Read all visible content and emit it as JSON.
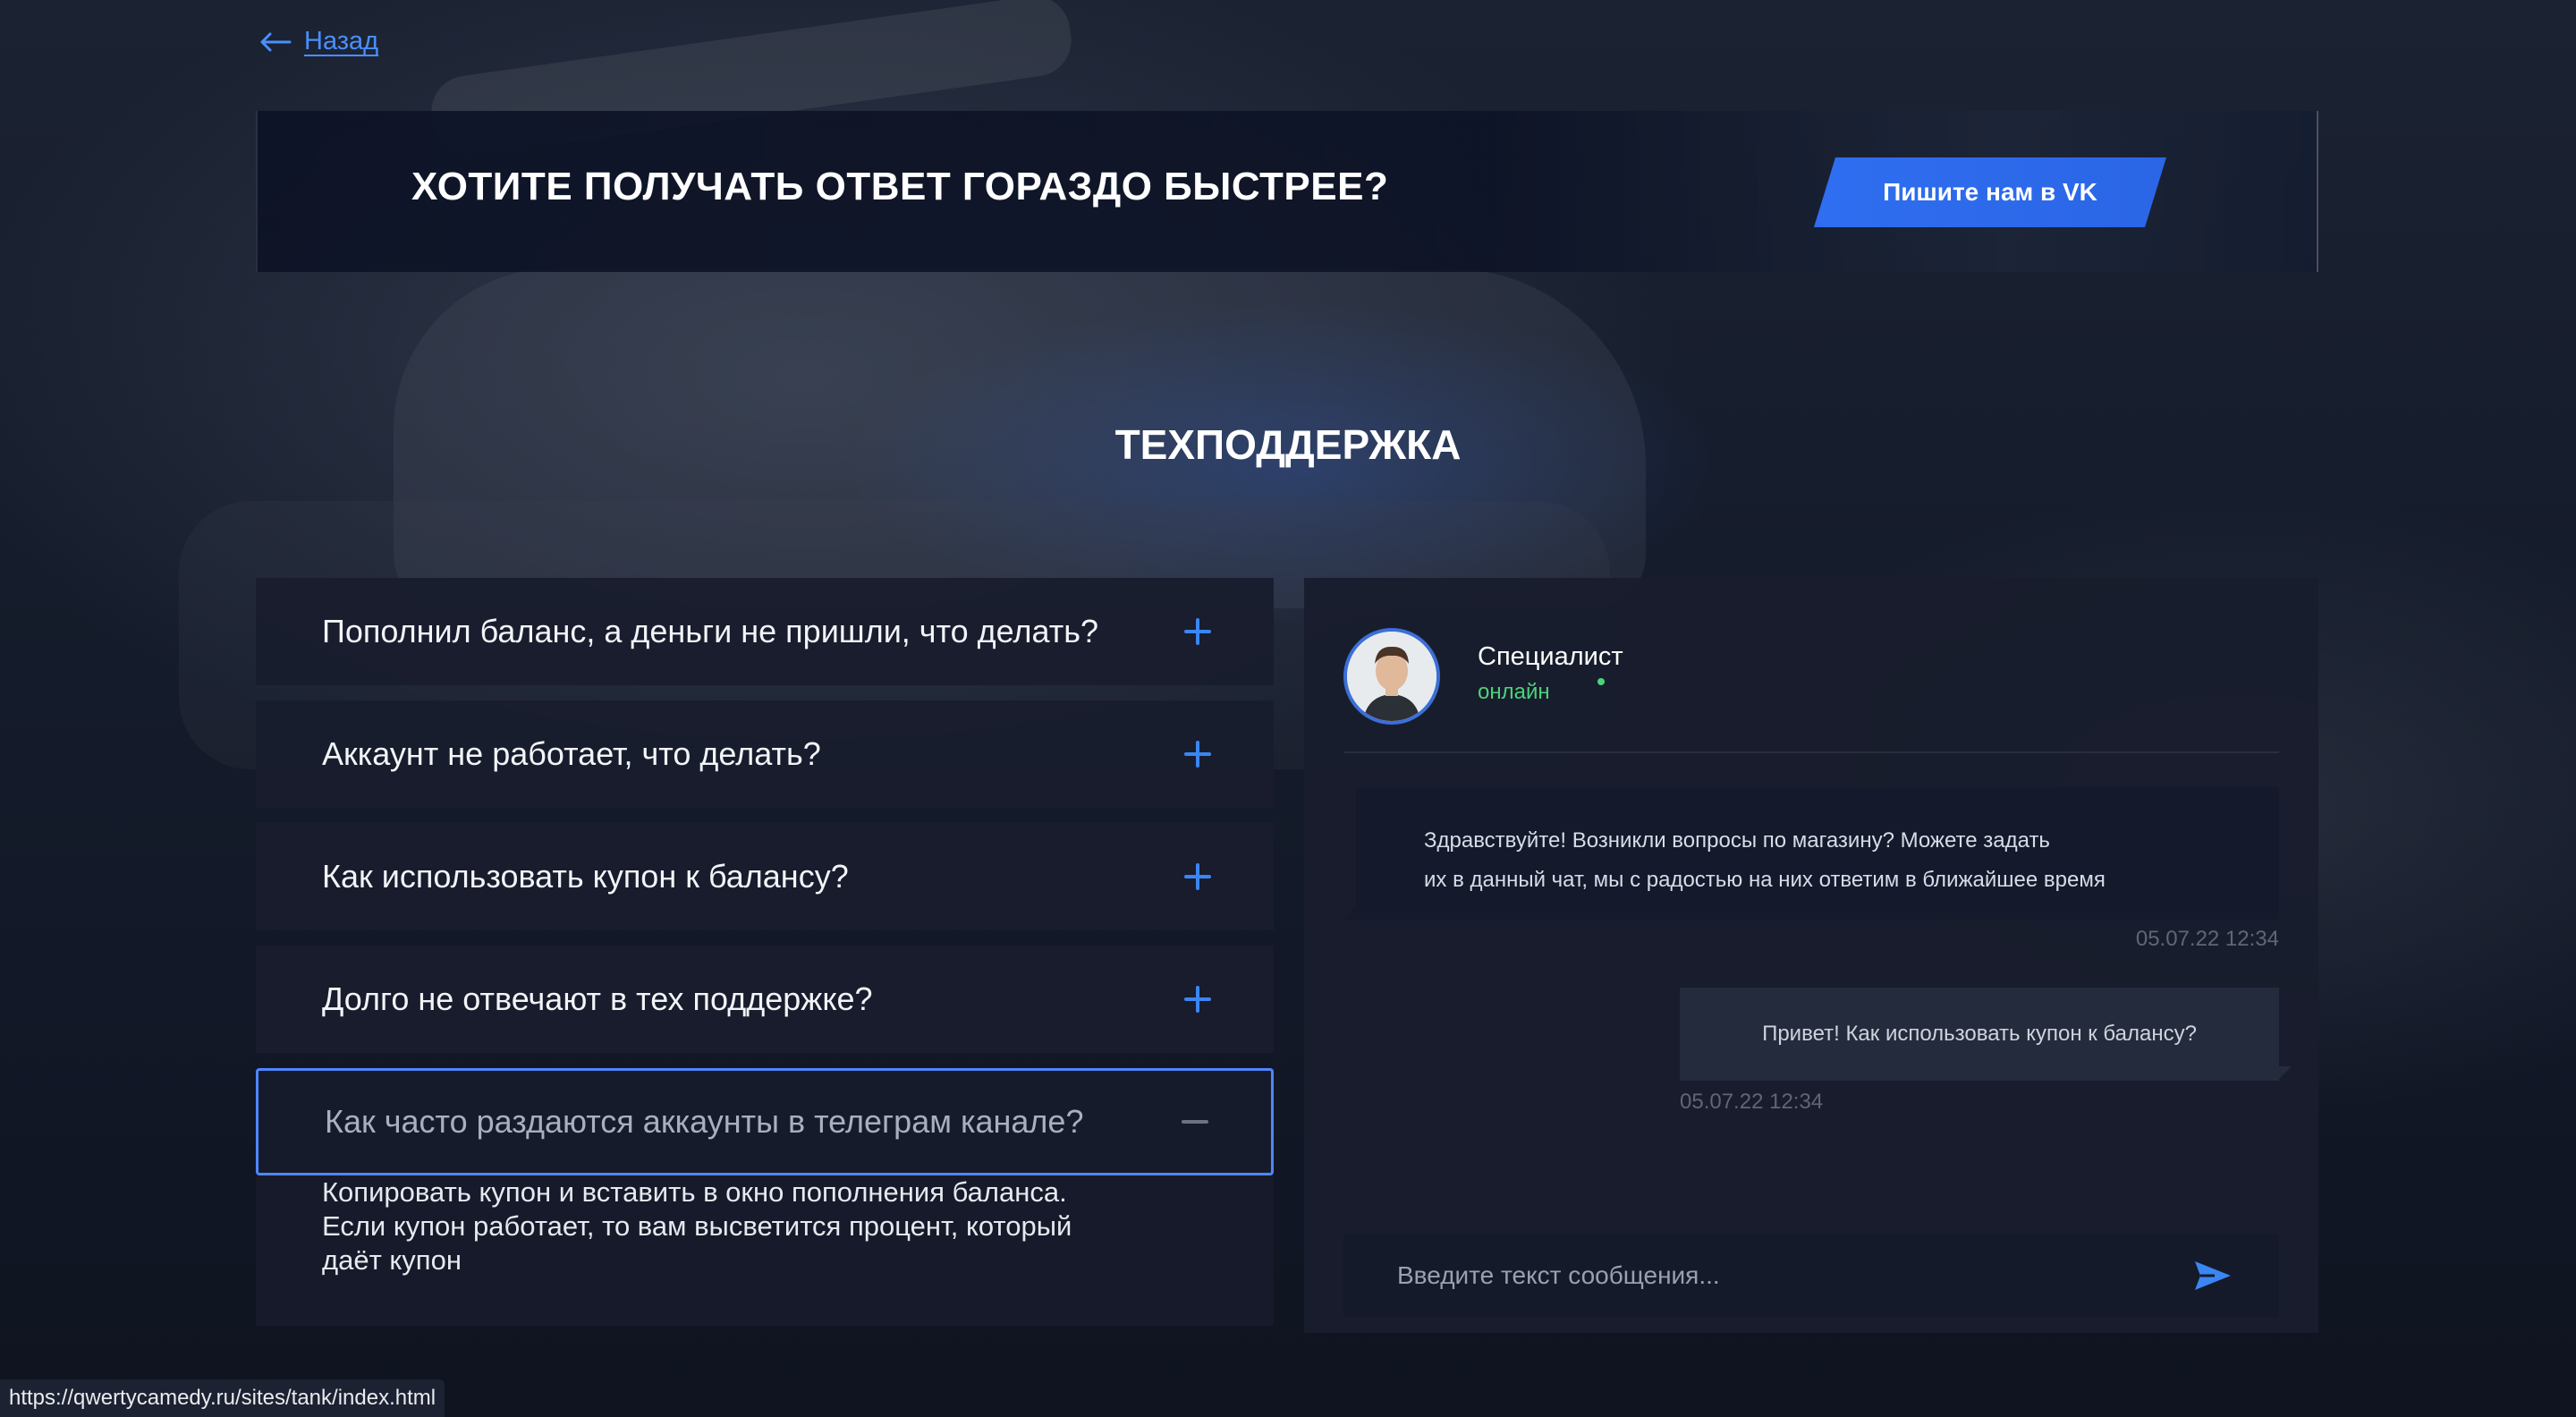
{
  "nav": {
    "back_label": "Назад"
  },
  "banner": {
    "title": "ХОТИТЕ ПОЛУЧАТЬ ОТВЕТ ГОРАЗДО БЫСТРЕЕ?",
    "button_label": "Пишите нам в VK"
  },
  "section_title": "ТЕХПОДДЕРЖКА",
  "faq": {
    "items": [
      {
        "question": "Пополнил баланс, а деньги не пришли, что делать?",
        "state": "collapsed"
      },
      {
        "question": "Аккаунт не работает, что делать?",
        "state": "collapsed"
      },
      {
        "question": "Как использовать купон к балансу?",
        "state": "collapsed"
      },
      {
        "question": "Долго не отвечают в тех поддержке?",
        "state": "collapsed"
      },
      {
        "question": "Как часто раздаются аккаунты в телеграм канале?",
        "state": "expanded"
      }
    ],
    "answer": "Копировать купон и вставить в окно пополнения баланса. Если купон работает, то вам высветится процент, который даёт купон"
  },
  "chat": {
    "agent_name": "Специалист",
    "agent_status": "онлайн",
    "messages": [
      {
        "direction": "incoming",
        "line1": "Здравствуйте! Возникли вопросы по магазину? Можете задать",
        "line2": "их в данный чат, мы с радостью на них ответим в ближайшее время",
        "time": "05.07.22 12:34"
      },
      {
        "direction": "outgoing",
        "text": "Привет! Как использовать купон к балансу?",
        "time": "05.07.22 12:34"
      }
    ],
    "input_placeholder": "Введите текст сообщения..."
  },
  "status_bar": {
    "url": "https://qwertycamedy.ru/sites/tank/index.html"
  },
  "colors": {
    "accent_blue": "#3a86f2",
    "button_blue": "#2f6ef0",
    "online_green": "#4cd37a",
    "active_border": "#4f86ff"
  },
  "icons": {
    "back": "arrow-left-icon",
    "expand": "plus-icon",
    "collapse": "minus-icon",
    "send": "send-icon",
    "avatar": "avatar"
  }
}
